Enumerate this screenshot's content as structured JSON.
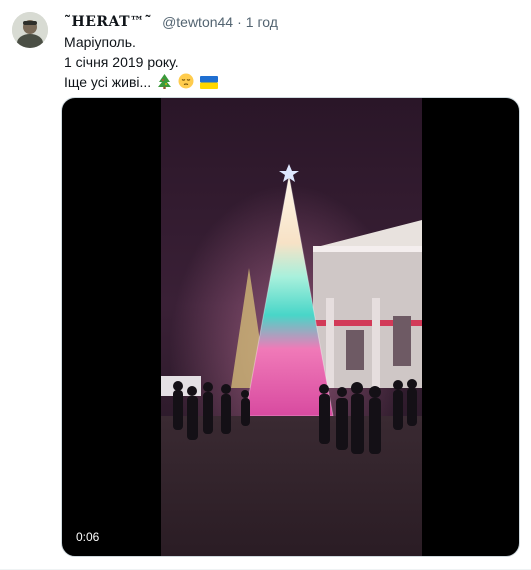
{
  "tweet": {
    "display_name": "˜HERAT™˜",
    "handle": "@tewton44",
    "separator": "·",
    "time": "1 год",
    "lines": [
      "Маріуполь.",
      "1 січня 2019 року.",
      "Іще усі живі..."
    ],
    "emojis": [
      "christmas-tree-icon",
      "pensive-face-icon",
      "ukraine-flag-icon"
    ]
  },
  "media": {
    "video_time": "0:06"
  }
}
